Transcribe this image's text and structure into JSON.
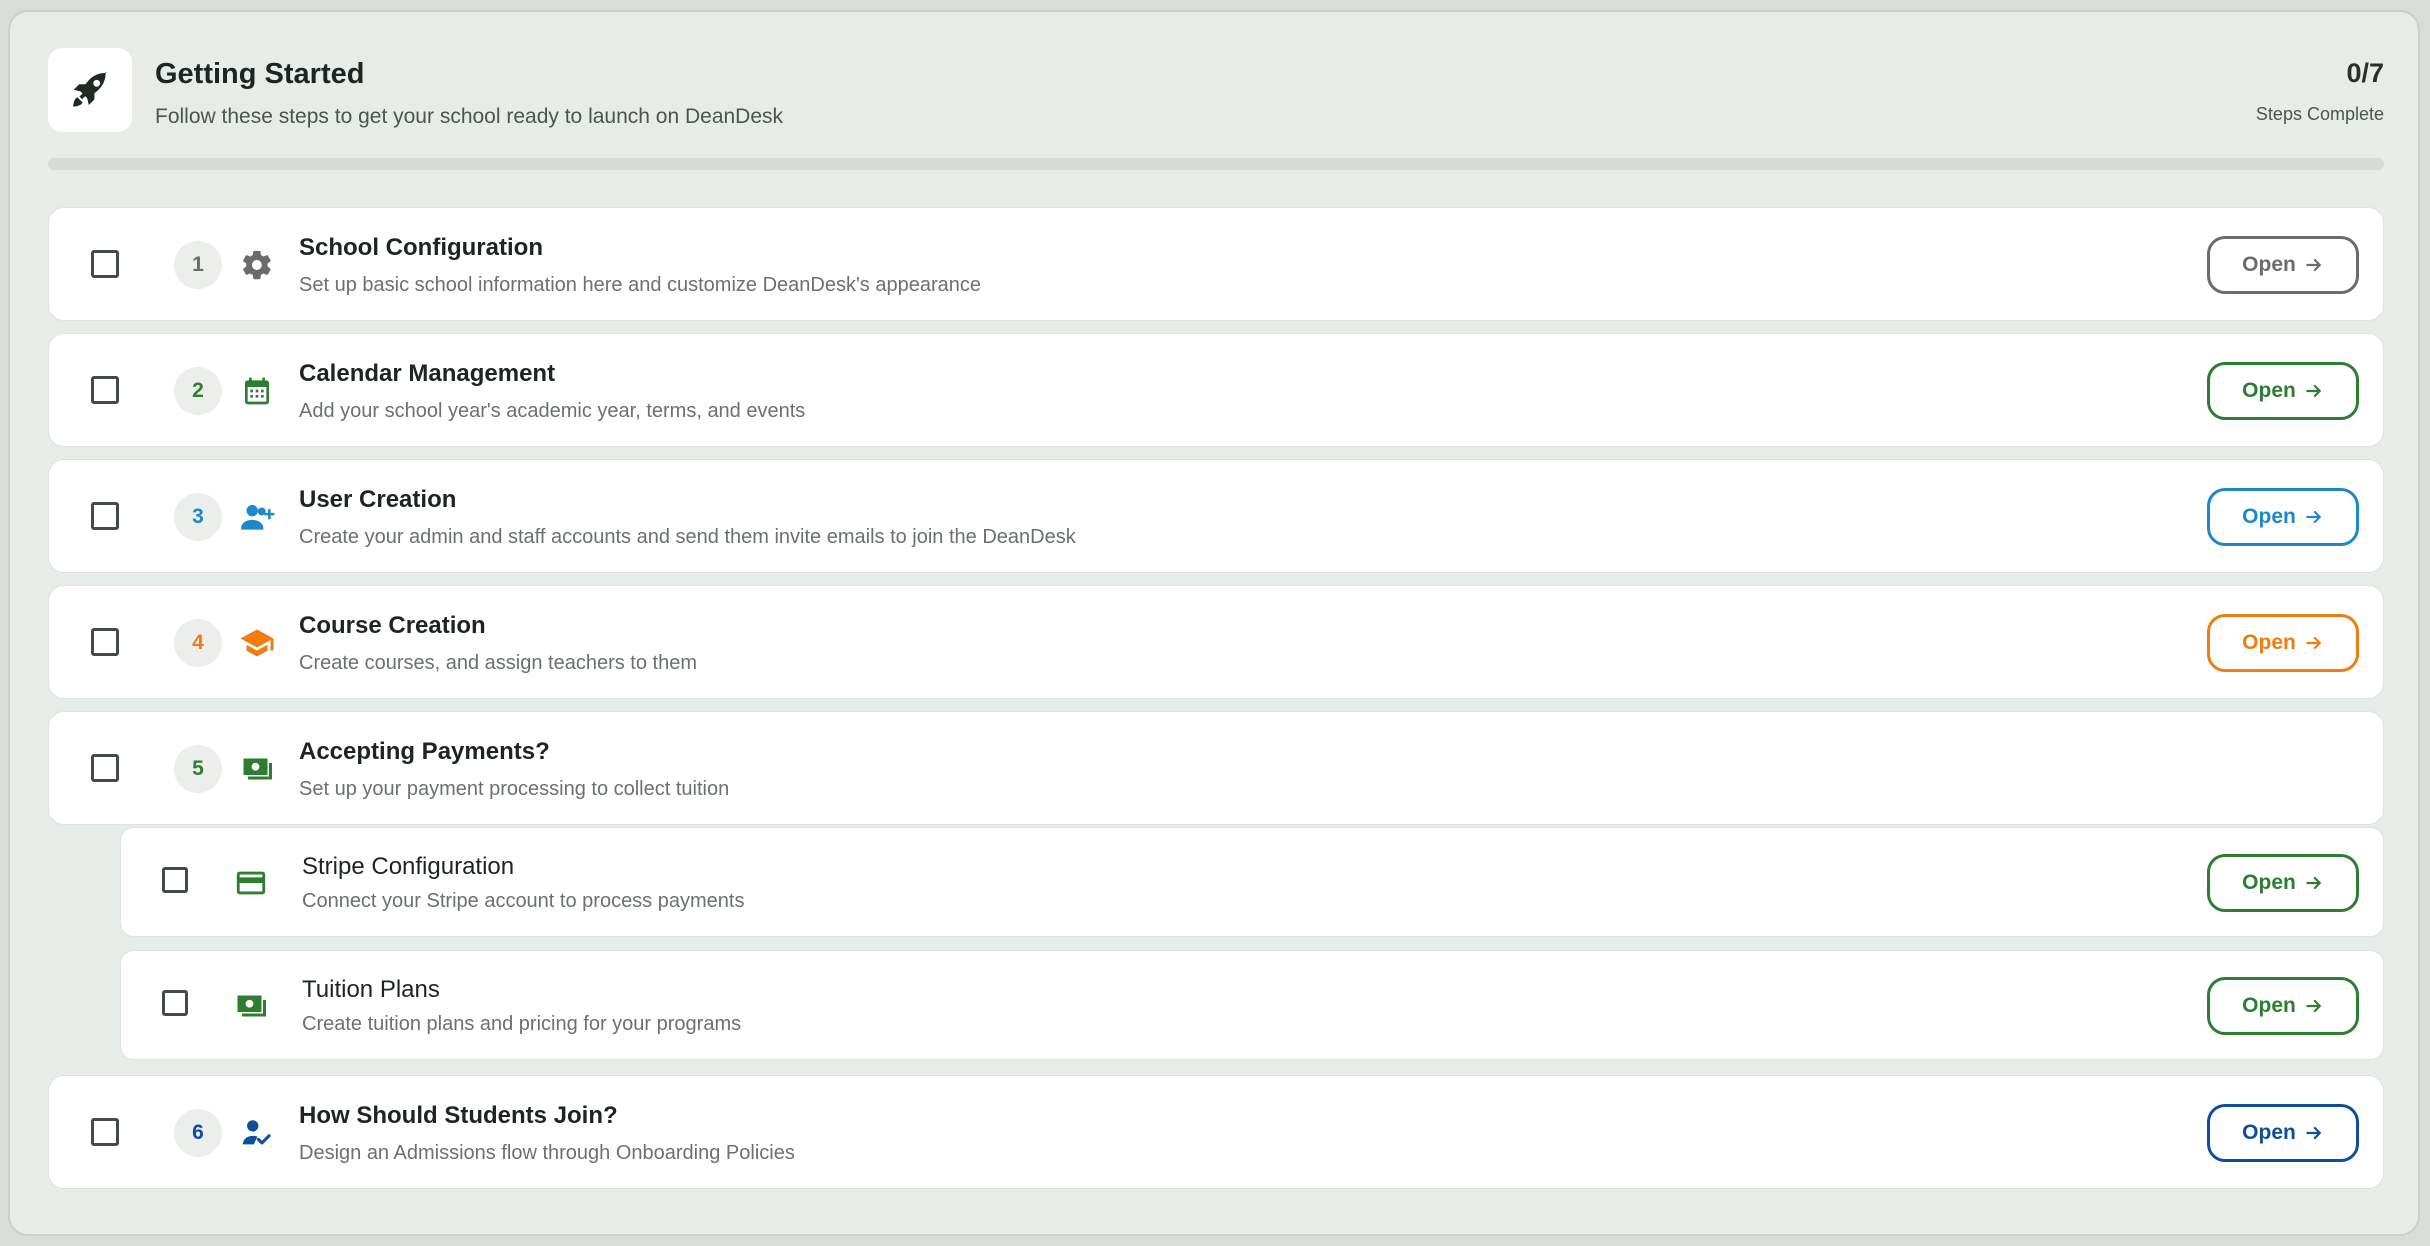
{
  "header": {
    "title": "Getting Started",
    "subtitle": "Follow these steps to get your school ready to launch on DeanDesk",
    "count": "0/7",
    "count_label": "Steps Complete",
    "progress": 0,
    "logo_icon": "rocket-icon"
  },
  "steps": [
    {
      "number": "1",
      "title": "School Configuration",
      "description": "Set up basic school information here and customize DeanDesk's appearance",
      "icon": "gear-icon",
      "color": "#6b6b6b",
      "button": "Open"
    },
    {
      "number": "2",
      "title": "Calendar Management",
      "description": "Add your school year's academic year, terms, and events",
      "icon": "calendar-icon",
      "color": "#2e7d32",
      "button": "Open"
    },
    {
      "number": "3",
      "title": "User Creation",
      "description": "Create your admin and staff accounts and send them invite emails to join the DeanDesk",
      "icon": "add-users-icon",
      "color": "#1f87c9",
      "button": "Open"
    },
    {
      "number": "4",
      "title": "Course Creation",
      "description": "Create courses, and assign teachers to them",
      "icon": "graduation-cap-icon",
      "color": "#ef7d0f",
      "button": "Open"
    },
    {
      "number": "5",
      "title": "Accepting Payments?",
      "description": "Set up your payment processing to collect tuition",
      "icon": "money-icon",
      "color": "#2e7d32"
    },
    {
      "number": "6",
      "title": "How Should Students Join?",
      "description": "Design an Admissions flow through Onboarding Policies",
      "icon": "person-check-icon",
      "color": "#0d4f9a",
      "button": "Open"
    }
  ],
  "substeps": [
    {
      "title": "Stripe Configuration",
      "description": "Connect your Stripe account to process payments",
      "icon": "credit-card-icon",
      "color": "#2e7d32",
      "button": "Open"
    },
    {
      "title": "Tuition Plans",
      "description": "Create tuition plans and pricing for your programs",
      "icon": "money-icon",
      "color": "#2e7d32",
      "button": "Open"
    }
  ]
}
